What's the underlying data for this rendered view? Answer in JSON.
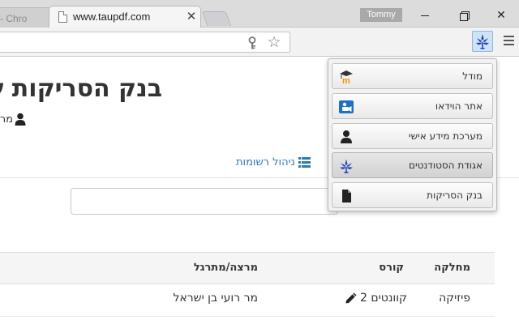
{
  "browser": {
    "prev_tab_title": "- Chro",
    "active_tab_title": "www.taupdf.com",
    "tab_close_glyph": "✕",
    "user_name": "Tommy",
    "window_close_glyph": "✕",
    "bookmark_glyph": "☆"
  },
  "page": {
    "title": "בנק הסריקות ש",
    "author_prefix": "מר",
    "manage_lists_label": "ניהול רשומות",
    "search_placeholder": ""
  },
  "table": {
    "headers": {
      "department": "מחלקה",
      "course": "קורס",
      "lecturer": "מרצה/מתרגל"
    },
    "rows": [
      {
        "department": "פיזיקה",
        "course": "קוונטים 2",
        "lecturer": "מר רועי בן ישראל"
      }
    ]
  },
  "extension_menu": {
    "items": [
      {
        "label": "מודל",
        "icon": "moodle-icon"
      },
      {
        "label": "אתר הוידאו",
        "icon": "video-icon"
      },
      {
        "label": "מערכת מידע אישי",
        "icon": "person-icon"
      },
      {
        "label": "אגודת הסטודנטים",
        "icon": "student-union-icon"
      },
      {
        "label": "בנק הסריקות",
        "icon": "document-icon"
      }
    ],
    "selected_index": 3
  },
  "colors": {
    "link": "#2a7ab8",
    "union_blue": "#2342b5",
    "video_blue": "#1f6fc3",
    "moodle_orange": "#f39200"
  }
}
